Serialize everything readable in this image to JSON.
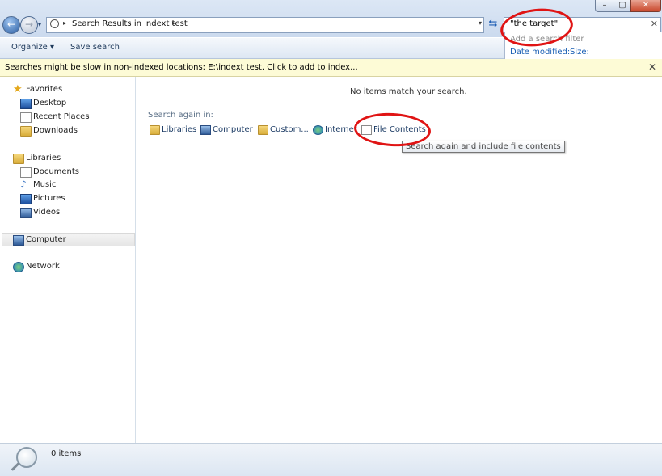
{
  "window": {
    "minimize": "–",
    "maximize": "▢",
    "close": "✕"
  },
  "address": {
    "path": "Search Results in indext test",
    "sep": "▸",
    "dropdown": "▾"
  },
  "search": {
    "value": "\"the target\"",
    "clear": "✕",
    "filter_hint": "Add a search filter",
    "filters": [
      "Date modified:",
      "Size:"
    ]
  },
  "toolbar": {
    "organize": "Organize ▾",
    "save_search": "Save search"
  },
  "infobar": {
    "text": "Searches might be slow in non-indexed locations: E:\\indext test. Click to add to index...",
    "close": "✕"
  },
  "nav": {
    "favorites": "Favorites",
    "favorites_items": [
      "Desktop",
      "Recent Places",
      "Downloads"
    ],
    "libraries": "Libraries",
    "libraries_items": [
      "Documents",
      "Music",
      "Pictures",
      "Videos"
    ],
    "computer": "Computer",
    "network": "Network"
  },
  "content": {
    "empty_message": "No items match your search.",
    "search_again_label": "Search again in:",
    "search_again_items": [
      "Libraries",
      "Computer",
      "Custom...",
      "Internet",
      "File Contents"
    ],
    "tooltip": "Search again and include file contents"
  },
  "status": {
    "items": "0 items"
  },
  "colors": {
    "annotation": "#e01414",
    "link": "#1a5fb4",
    "infobar": "#fdfbd6"
  }
}
